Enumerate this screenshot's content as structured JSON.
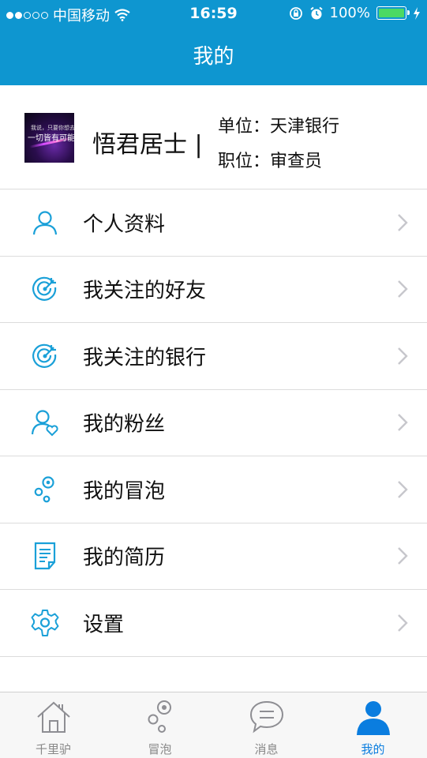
{
  "status_bar": {
    "carrier": "中国移动",
    "time": "16:59",
    "battery": "100%",
    "signal_bars": 2,
    "signal_total": 5
  },
  "nav": {
    "title": "我的"
  },
  "profile": {
    "avatar_line1": "我说，只要你想去",
    "avatar_line2": "一切皆有可能",
    "name": "悟君居士 |",
    "unit": "单位：天津银行",
    "position": "职位：审查员"
  },
  "menu": [
    {
      "label": "个人资料",
      "icon": "user-icon"
    },
    {
      "label": "我关注的好友",
      "icon": "target-icon"
    },
    {
      "label": "我关注的银行",
      "icon": "target-icon"
    },
    {
      "label": "我的粉丝",
      "icon": "user-heart-icon"
    },
    {
      "label": "我的冒泡",
      "icon": "bubbles-icon"
    },
    {
      "label": "我的简历",
      "icon": "document-icon"
    },
    {
      "label": "设置",
      "icon": "gear-icon"
    }
  ],
  "tabbar": [
    {
      "label": "千里驴",
      "icon": "home-icon"
    },
    {
      "label": "冒泡",
      "icon": "bubbles-icon"
    },
    {
      "label": "消息",
      "icon": "chat-icon"
    },
    {
      "label": "我的",
      "icon": "person-icon",
      "active": true
    }
  ],
  "colors": {
    "brand": "#0e96d0",
    "icon": "#1aa0d8",
    "active_tab": "#0a7ddf",
    "battery": "#4cd964"
  }
}
